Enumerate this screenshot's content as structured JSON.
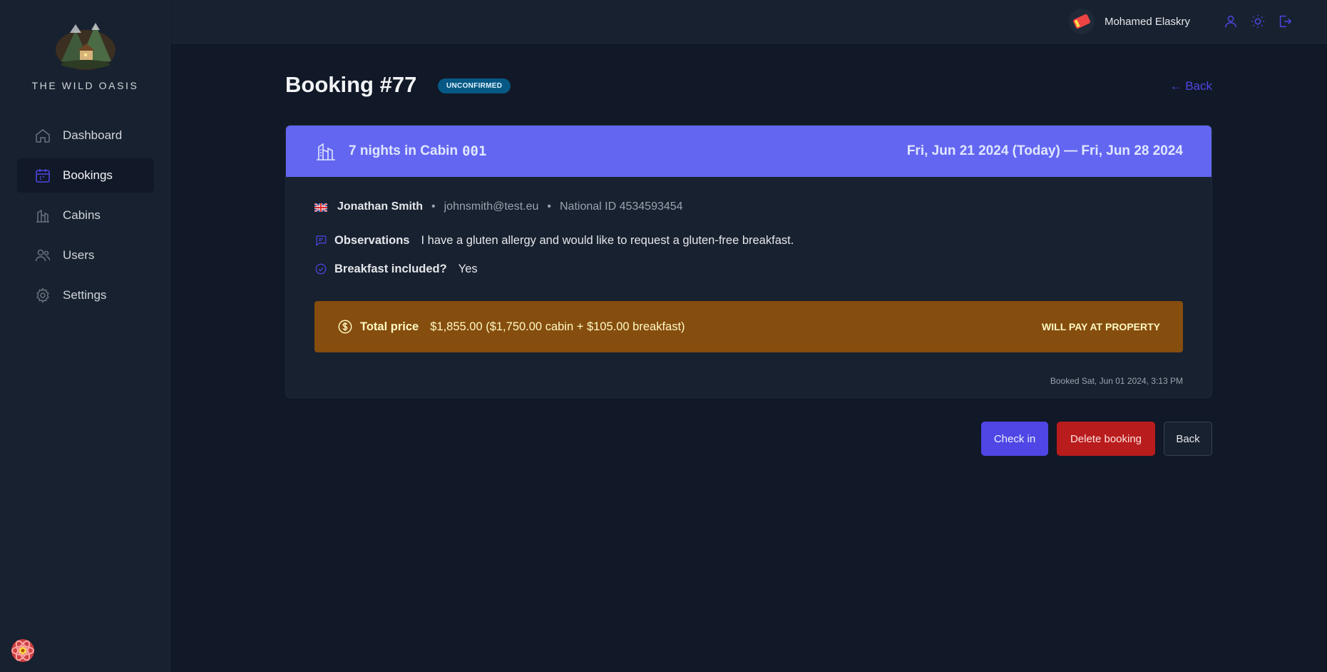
{
  "app": {
    "brand": "THE WILD OASIS"
  },
  "sidebar": {
    "items": [
      {
        "label": "Dashboard",
        "icon": "home-icon"
      },
      {
        "label": "Bookings",
        "icon": "calendar-icon",
        "active": true
      },
      {
        "label": "Cabins",
        "icon": "cabins-icon"
      },
      {
        "label": "Users",
        "icon": "users-icon"
      },
      {
        "label": "Settings",
        "icon": "gear-icon"
      }
    ]
  },
  "header": {
    "user_name": "Mohamed Elaskry",
    "icons": [
      "user-icon",
      "sun-icon",
      "logout-icon"
    ]
  },
  "booking": {
    "title": "Booking #77",
    "status": "UNCONFIRMED",
    "back_link": "← Back",
    "nights_text": "7 nights in Cabin",
    "cabin_code": "001",
    "dates": "Fri, Jun 21 2024 (Today) — Fri, Jun 28 2024",
    "guest_name": "Jonathan Smith",
    "guest_email": "johnsmith@test.eu",
    "national_id": "National ID 4534593454",
    "observations_label": "Observations",
    "observations": "I have a gluten allergy and would like to request a gluten-free breakfast.",
    "breakfast_label": "Breakfast included?",
    "breakfast_value": "Yes",
    "total_label": "Total price",
    "total_value": "$1,855.00 ($1,750.00 cabin + $105.00 breakfast)",
    "payment_status": "WILL PAY AT PROPERTY",
    "booked_at": "Booked Sat, Jun 01 2024, 3:13 PM"
  },
  "actions": {
    "check_in": "Check in",
    "delete": "Delete booking",
    "back": "Back"
  },
  "colors": {
    "accent": "#4f46e5",
    "header_bar": "#6366f1",
    "price_box": "#854d0e",
    "danger": "#b91c1c",
    "badge": "#075985"
  }
}
